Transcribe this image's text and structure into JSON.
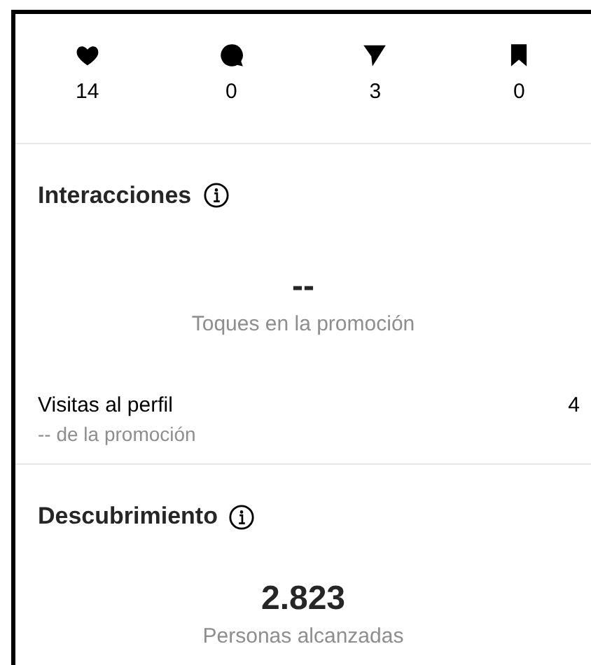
{
  "stats": [
    {
      "kind": "heart",
      "value": "14"
    },
    {
      "kind": "comment",
      "value": "0"
    },
    {
      "kind": "share",
      "value": "3"
    },
    {
      "kind": "save",
      "value": "0"
    }
  ],
  "interactions": {
    "title": "Interacciones",
    "big_value": "--",
    "big_label": "Toques en la promoción",
    "rows": [
      {
        "label": "Visitas al perfil",
        "sublabel": "-- de la promoción",
        "value": "4"
      }
    ]
  },
  "discovery": {
    "title": "Descubrimiento",
    "big_value": "2.823",
    "big_label": "Personas alcanzadas"
  }
}
